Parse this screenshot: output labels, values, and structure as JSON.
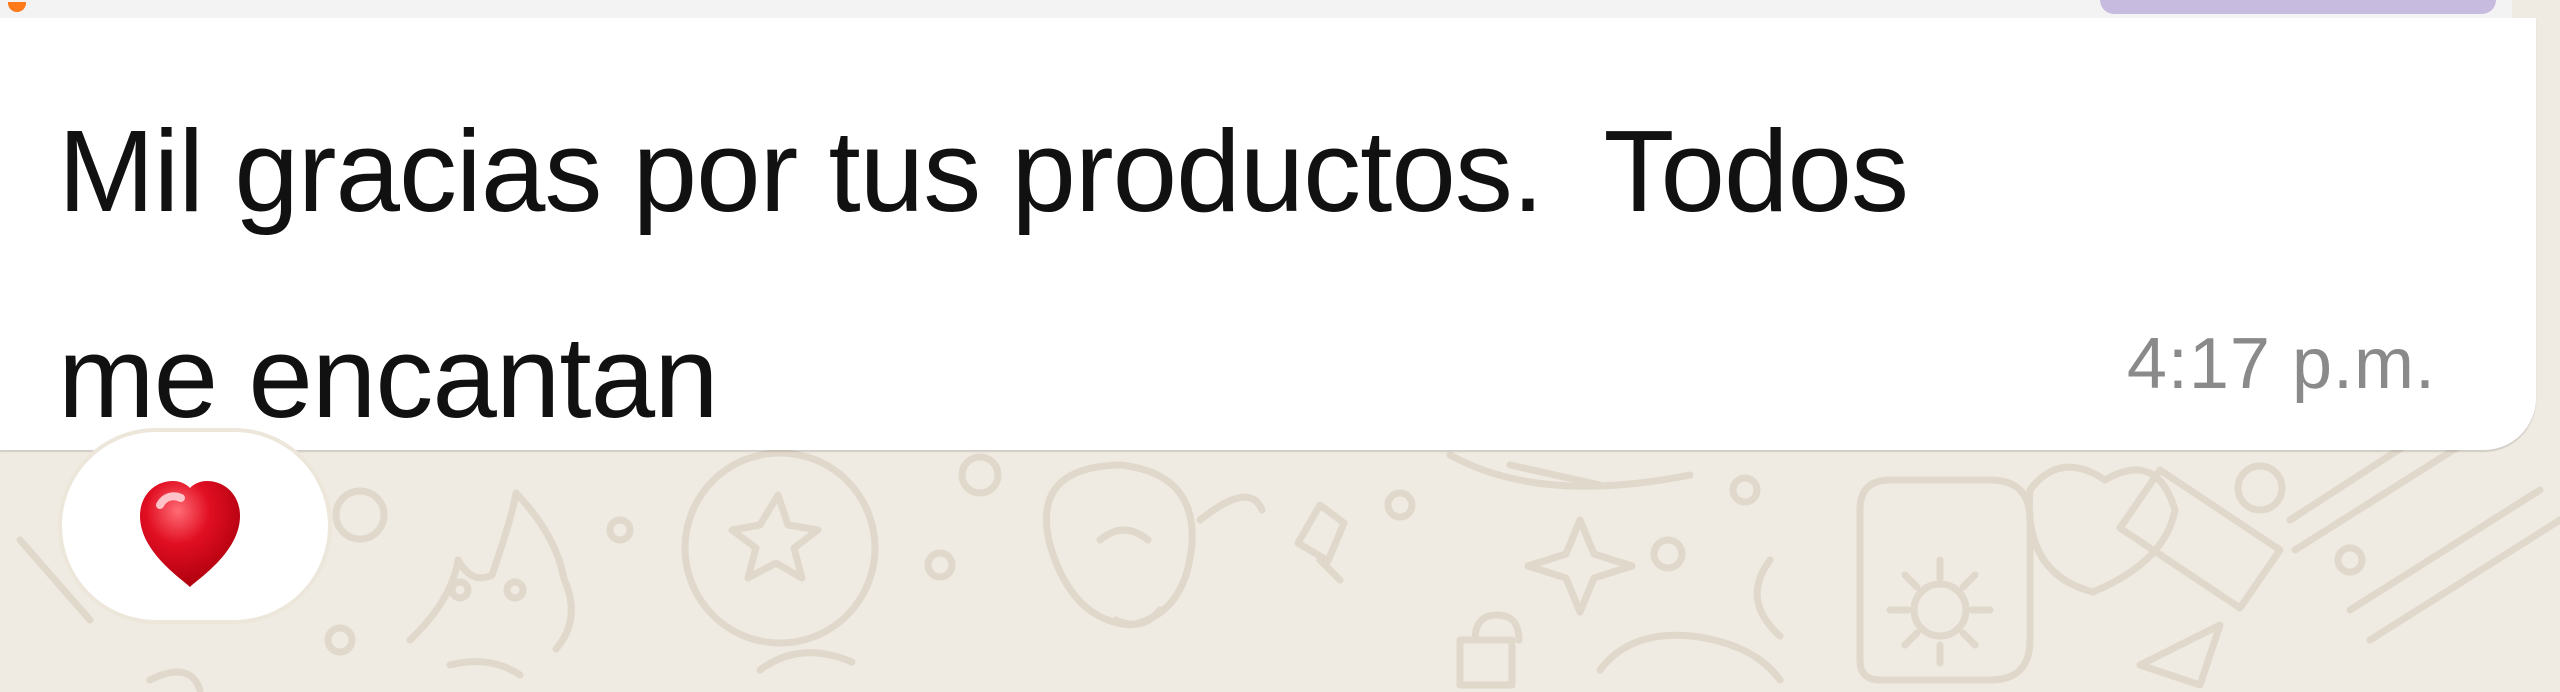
{
  "message": {
    "line_1": "Mil gracias por tus productos.  Todos",
    "line_2": "me encantan",
    "time": "4:17 p.m."
  },
  "reaction": {
    "emoji_name": "red-heart-icon",
    "emoji": "❤️"
  },
  "theme": {
    "chat_background": "#efeae2",
    "bubble_background": "#ffffff",
    "text_color": "#111111",
    "timestamp_color": "#8a8a8a",
    "reaction_border": "#ede6da",
    "top_accent_color": "#c8bbe0",
    "emoji_color": "#e10f22"
  }
}
